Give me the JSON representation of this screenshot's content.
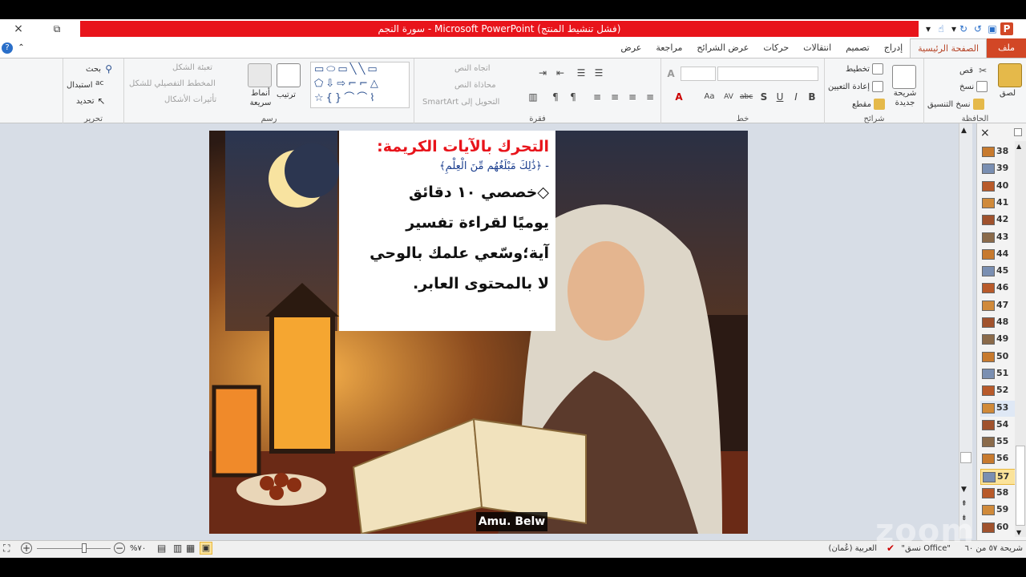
{
  "window": {
    "title": "سورة النجم - Microsoft PowerPoint (فشل تنشيط المنتج)",
    "accent_color": "#e8141b"
  },
  "zoom_controls": {
    "close_icon": "×",
    "restore_icon": "⧉"
  },
  "tabs": [
    {
      "label": "ملف"
    },
    {
      "label": "الصفحة الرئيسية"
    },
    {
      "label": "إدراج"
    },
    {
      "label": "تصميم"
    },
    {
      "label": "انتقالات"
    },
    {
      "label": "حركات"
    },
    {
      "label": "عرض الشرائح"
    },
    {
      "label": "مراجعة"
    },
    {
      "label": "عرض"
    }
  ],
  "ribbon": {
    "clipboard": {
      "label": "الحافظة",
      "paste": "لصق",
      "cut": "قص",
      "copy": "نسخ",
      "format_painter": "نسخ التنسيق"
    },
    "slides": {
      "label": "شرائح",
      "new_slide": "شريحة جديدة",
      "layout": "تخطيط",
      "reset": "إعادة التعيين",
      "section": "مقطع"
    },
    "font": {
      "label": "خط"
    },
    "paragraph": {
      "label": "فقرة",
      "text_direction": "اتجاه النص",
      "align_text": "محاذاة النص",
      "convert_smartart": "التحويل إلى SmartArt"
    },
    "drawing": {
      "label": "رسم",
      "arrange": "ترتيب",
      "quick_styles": "أنماط سريعة",
      "shape_fill": "تعبئة الشكل",
      "shape_outline": "المخطط التفصيلي للشكل",
      "shape_effects": "تأثيرات الأشكال"
    },
    "editing": {
      "label": "تحرير",
      "find": "بحث",
      "replace": "استبدال",
      "select": "تحديد"
    }
  },
  "slide": {
    "title": "التحرك بالآيات الكريمة:",
    "verse": "- ﴿ذَٰلِكَ مَبْلَغُهُم مِّنَ الْعِلْمِ﴾",
    "body_lines": [
      "◇خصصي ١٠ دقائق",
      "يوميًا لقراءة تفسير",
      "آية؛وسّعي علمك بالوحي",
      "لا بالمحتوى العابر."
    ],
    "caption": "Amu. Belw"
  },
  "thumbnails": [
    {
      "num": "38"
    },
    {
      "num": "39"
    },
    {
      "num": "40"
    },
    {
      "num": "41"
    },
    {
      "num": "42"
    },
    {
      "num": "43"
    },
    {
      "num": "44"
    },
    {
      "num": "45"
    },
    {
      "num": "46"
    },
    {
      "num": "47"
    },
    {
      "num": "48"
    },
    {
      "num": "49"
    },
    {
      "num": "50"
    },
    {
      "num": "51"
    },
    {
      "num": "52"
    },
    {
      "num": "53"
    },
    {
      "num": "54"
    },
    {
      "num": "55"
    },
    {
      "num": "56"
    },
    {
      "num": "57"
    },
    {
      "num": "58"
    },
    {
      "num": "59"
    },
    {
      "num": "60"
    }
  ],
  "selected_slide": "57",
  "status": {
    "slide_info": "شريحة ٥٧ من ٦٠",
    "theme": "\"نسق Office\"",
    "language": "العربية (عُمان)",
    "zoom": "%٧٠"
  },
  "watermark": "zoom"
}
